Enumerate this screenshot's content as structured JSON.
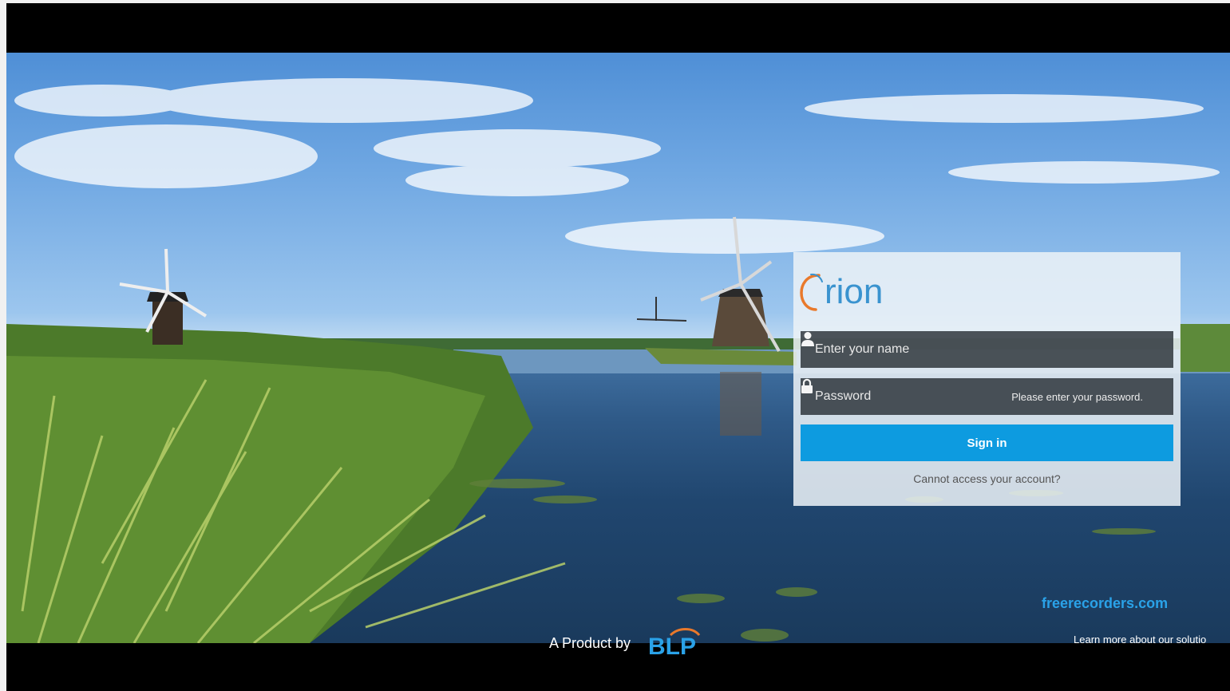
{
  "brand": {
    "logo_text": "rion",
    "accent": "#e9792b",
    "primary": "#3a93cf"
  },
  "login": {
    "name_placeholder": "Enter your name",
    "password_placeholder": "Password",
    "password_hint": "Please enter your password.",
    "signin_label": "Sign in",
    "forgot_label": "Cannot access your account?"
  },
  "footer": {
    "product_by": "A Product by",
    "product_logo": "BLP",
    "site_link": "freerecorders.com",
    "learn_more": "Learn more about our solutio"
  },
  "icons": {
    "user": "user-icon",
    "lock": "lock-icon"
  },
  "colors": {
    "button": "#0d9be0",
    "link": "#2aa2e8"
  }
}
